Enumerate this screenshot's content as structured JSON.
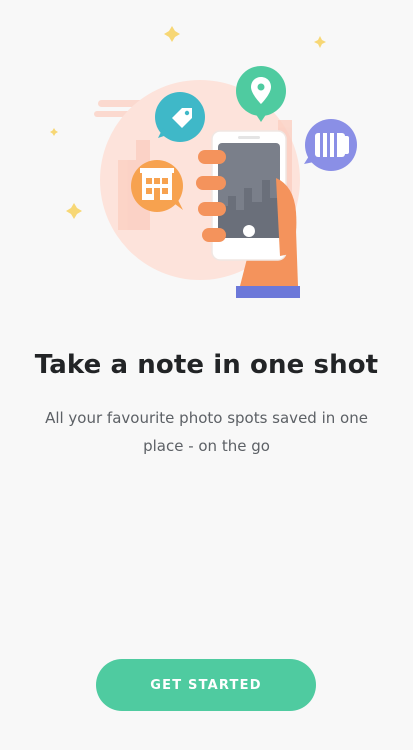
{
  "onboarding": {
    "title": "Take a note in one shot",
    "subtitle": "All your favourite photo spots saved in one place - on the go",
    "cta_label": "GET STARTED"
  },
  "illustration": {
    "icons": [
      "tag-icon",
      "map-pin-icon",
      "camera-lens-icon",
      "building-icon"
    ]
  },
  "colors": {
    "background": "#f8f8f8",
    "accent": "#4fcba0",
    "title": "#222426",
    "subtitle": "#5d6166"
  }
}
